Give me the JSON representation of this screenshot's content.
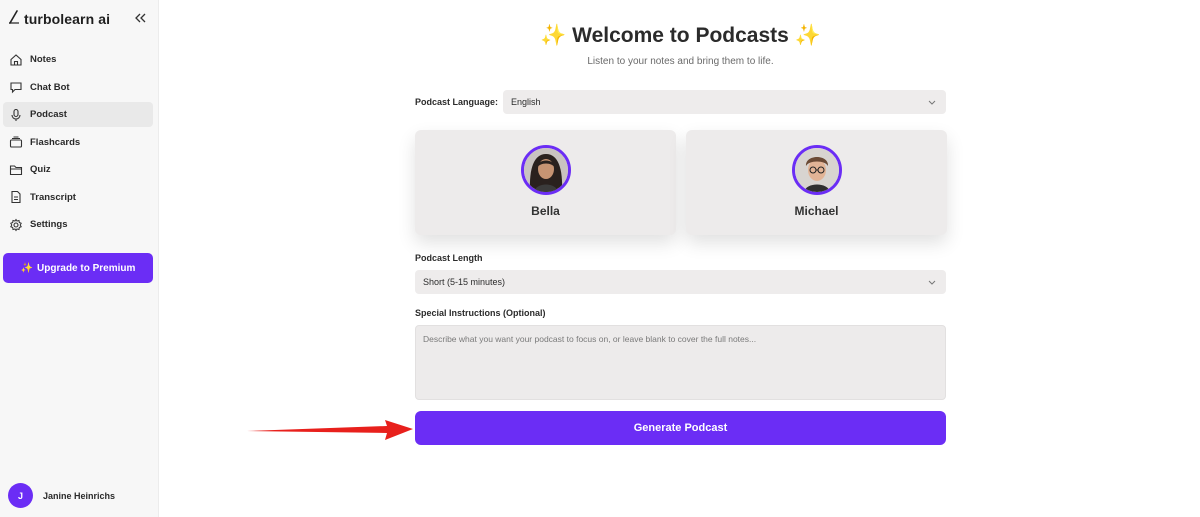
{
  "app": {
    "brand": "turbolearn ai"
  },
  "sidebar": {
    "items": [
      {
        "label": "Notes",
        "icon": "home-icon",
        "active": false
      },
      {
        "label": "Chat Bot",
        "icon": "chat-icon",
        "active": false
      },
      {
        "label": "Podcast",
        "icon": "microphone-icon",
        "active": true
      },
      {
        "label": "Flashcards",
        "icon": "cards-icon",
        "active": false
      },
      {
        "label": "Quiz",
        "icon": "folder-icon",
        "active": false
      },
      {
        "label": "Transcript",
        "icon": "document-icon",
        "active": false
      },
      {
        "label": "Settings",
        "icon": "gear-icon",
        "active": false
      }
    ],
    "upgrade_label": "Upgrade to Premium",
    "user": {
      "initial": "J",
      "name": "Janine Heinrichs"
    }
  },
  "main": {
    "title": "Welcome to Podcasts",
    "subtitle": "Listen to your notes and bring them to life.",
    "language": {
      "label": "Podcast Language:",
      "value": "English"
    },
    "voices": [
      {
        "name": "Bella"
      },
      {
        "name": "Michael"
      }
    ],
    "length": {
      "label": "Podcast Length",
      "value": "Short (5-15 minutes)"
    },
    "instructions": {
      "label": "Special Instructions (Optional)",
      "placeholder": "Describe what you want your podcast to focus on, or leave blank to cover the full notes...",
      "value": ""
    },
    "generate_label": "Generate Podcast"
  },
  "colors": {
    "accent": "#6b2df5",
    "sparkle": "#f5b942",
    "arrow": "#e8201c"
  }
}
